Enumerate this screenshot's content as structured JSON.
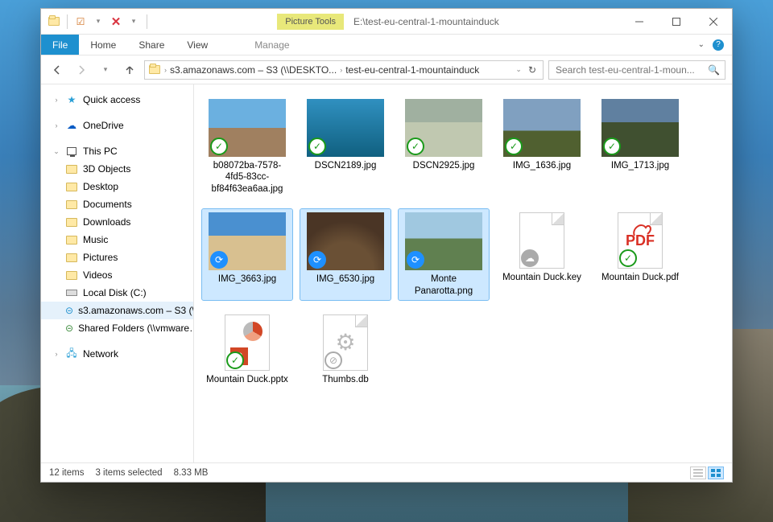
{
  "title": {
    "tools_label": "Picture Tools",
    "path": "E:\\test-eu-central-1-mountainduck"
  },
  "ribbon": {
    "file": "File",
    "home": "Home",
    "share": "Share",
    "view": "View",
    "manage": "Manage"
  },
  "breadcrumb": {
    "items": [
      "s3.amazonaws.com – S3 (\\\\DESKTO...",
      "test-eu-central-1-mountainduck"
    ]
  },
  "search": {
    "placeholder": "Search test-eu-central-1-moun..."
  },
  "sidebar": {
    "quick_access": "Quick access",
    "onedrive": "OneDrive",
    "this_pc": "This PC",
    "pc_children": [
      "3D Objects",
      "Desktop",
      "Documents",
      "Downloads",
      "Music",
      "Pictures",
      "Videos",
      "Local Disk (C:)",
      "s3.amazonaws.com – S3 (\\\\…",
      "Shared Folders (\\\\vmware…"
    ],
    "network": "Network"
  },
  "files": [
    {
      "name": "b08072ba-7578-4fd5-83cc-bf84f63ea6aa.jpg",
      "overlay": "check",
      "thumb": "photo",
      "selected": false
    },
    {
      "name": "DSCN2189.jpg",
      "overlay": "check",
      "thumb": "photo2",
      "selected": false
    },
    {
      "name": "DSCN2925.jpg",
      "overlay": "check",
      "thumb": "photo3",
      "selected": false
    },
    {
      "name": "IMG_1636.jpg",
      "overlay": "check",
      "thumb": "photo4",
      "selected": false
    },
    {
      "name": "IMG_1713.jpg",
      "overlay": "check",
      "thumb": "photo5",
      "selected": false
    },
    {
      "name": "IMG_3663.jpg",
      "overlay": "sync",
      "thumb": "beach",
      "selected": true
    },
    {
      "name": "IMG_6530.jpg",
      "overlay": "sync",
      "thumb": "dome",
      "selected": true
    },
    {
      "name": "Monte Panarotta.png",
      "overlay": "sync",
      "thumb": "flight",
      "selected": true
    },
    {
      "name": "Mountain Duck.key",
      "overlay": "cloud",
      "thumb": "doc-key",
      "selected": false
    },
    {
      "name": "Mountain Duck.pdf",
      "overlay": "check",
      "thumb": "doc-pdf",
      "selected": false
    },
    {
      "name": "Mountain Duck.pptx",
      "overlay": "check",
      "thumb": "doc-pptx",
      "selected": false
    },
    {
      "name": "Thumbs.db",
      "overlay": "block",
      "thumb": "doc-gears",
      "selected": false
    }
  ],
  "status": {
    "count": "12 items",
    "selected": "3 items selected",
    "size": "8.33 MB"
  }
}
